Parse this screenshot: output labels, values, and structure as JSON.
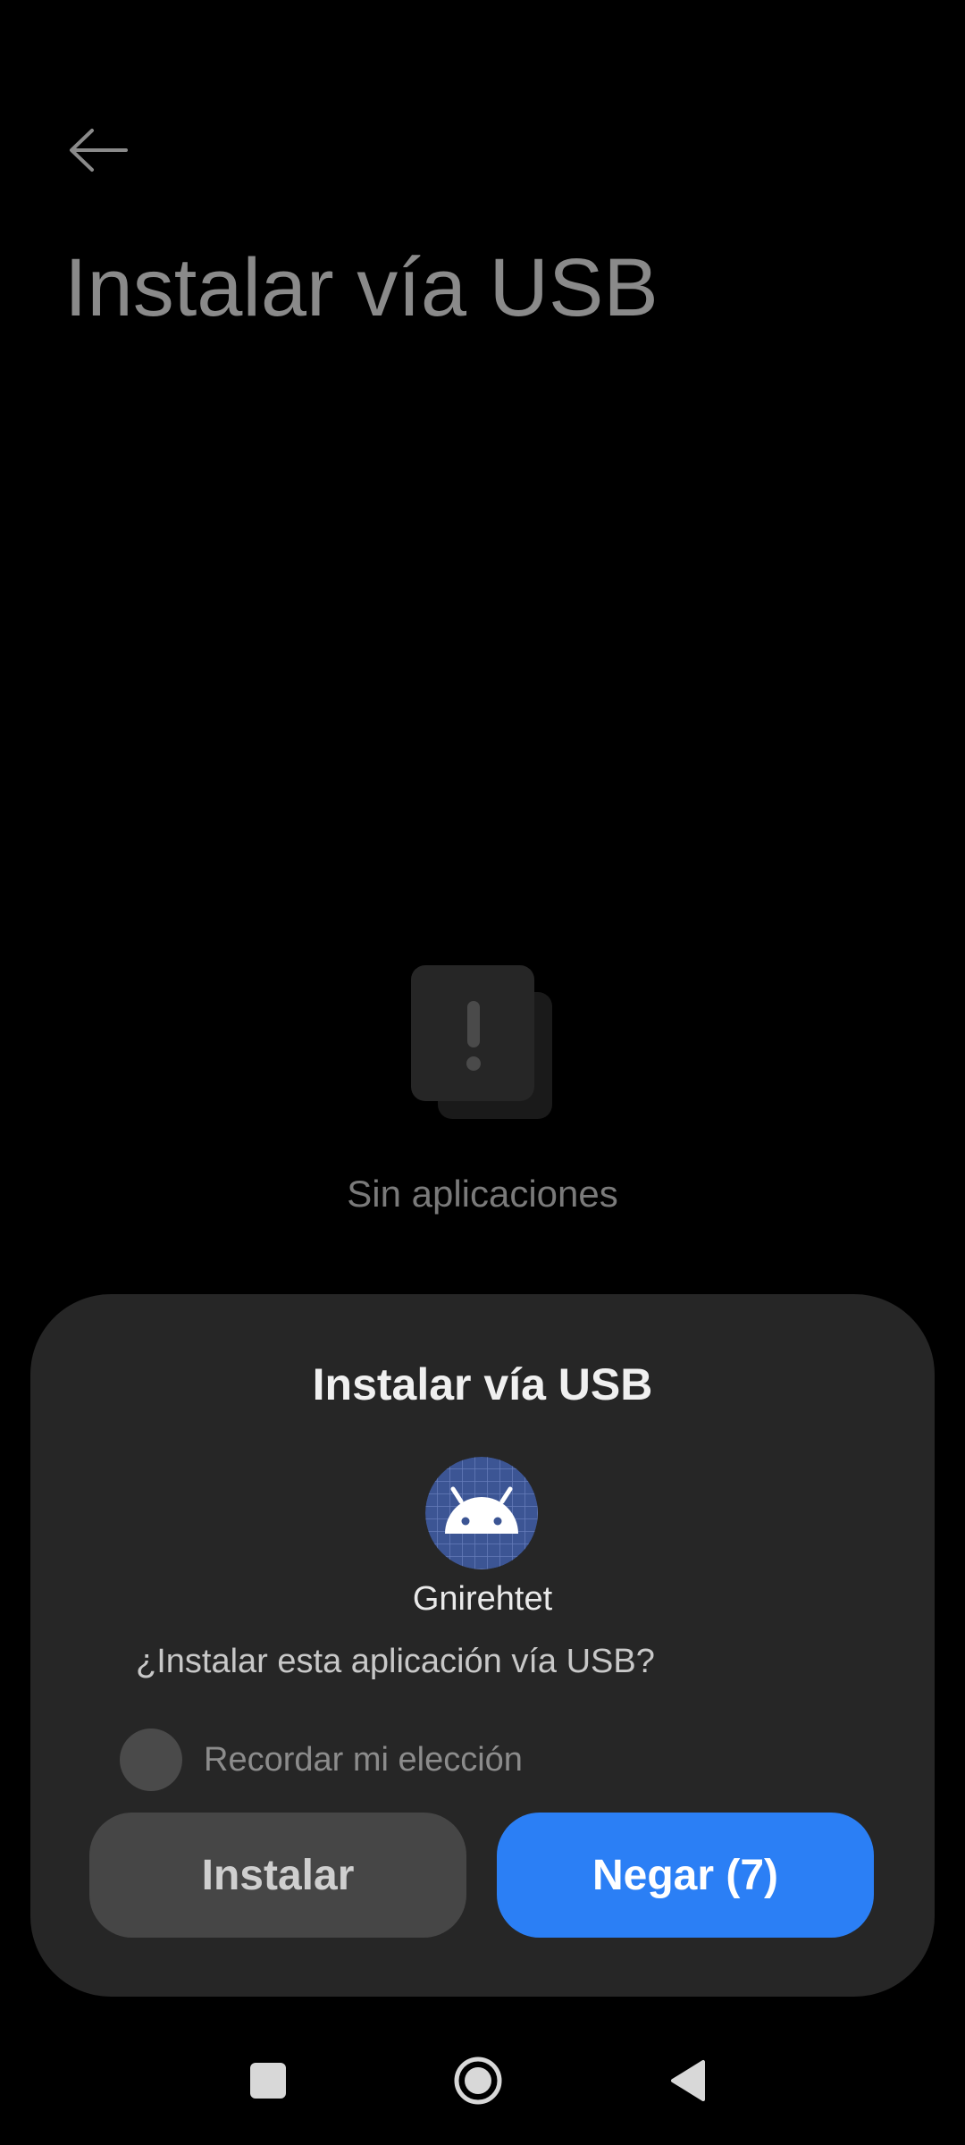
{
  "header": {
    "title": "Instalar vía USB",
    "back_icon": "arrow-left-icon"
  },
  "empty_state": {
    "icon": "exclamation-cards-icon",
    "text": "Sin aplicaciones"
  },
  "dialog": {
    "title": "Instalar vía USB",
    "app": {
      "name": "Gnirehtet",
      "icon": "android-robot-icon"
    },
    "question": "¿Instalar esta aplicación vía USB?",
    "remember_label": "Recordar mi elección",
    "remember_checked": false,
    "install_label": "Instalar",
    "deny_label": "Negar (7)"
  },
  "navbar": {
    "recents_icon": "square-icon",
    "home_icon": "circle-icon",
    "back_icon": "triangle-back-icon"
  },
  "colors": {
    "background": "#000000",
    "dialog": "#262626",
    "primary_button": "#2b7ff5",
    "secondary_button": "#464646",
    "app_icon_bg": "#3c5594"
  }
}
